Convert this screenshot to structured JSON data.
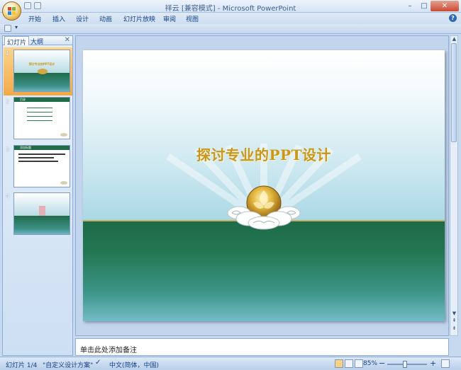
{
  "window": {
    "title": "祥云 [兼容模式] - Microsoft PowerPoint",
    "minimize": "–",
    "maximize": "□",
    "close": "✕"
  },
  "ribbon_tabs": [
    "开始",
    "插入",
    "设计",
    "动画",
    "幻灯片放映",
    "审阅",
    "视图"
  ],
  "help_icon": "?",
  "left_pane": {
    "tabs": [
      "幻灯片",
      "大纲"
    ],
    "close": "✕",
    "slides": [
      {
        "number": "1",
        "title": "探讨专业的PPT设计"
      },
      {
        "number": "2",
        "title": "目录"
      },
      {
        "number": "3",
        "title": "添加标题"
      },
      {
        "number": "4",
        "title": ""
      }
    ]
  },
  "slide": {
    "title": "探讨专业的PPT设计"
  },
  "notes": {
    "placeholder": "单击此处添加备注"
  },
  "status": {
    "slide_info": "幻灯片 1/4",
    "theme": "\"自定义设计方案\"",
    "language": "中文(简体，中国)",
    "zoom": "85%",
    "zoom_minus": "−",
    "zoom_plus": "+"
  },
  "colors": {
    "title_gold": "#c9971f",
    "green_band": "#1e6a48",
    "selection_orange": "#f3a945"
  }
}
